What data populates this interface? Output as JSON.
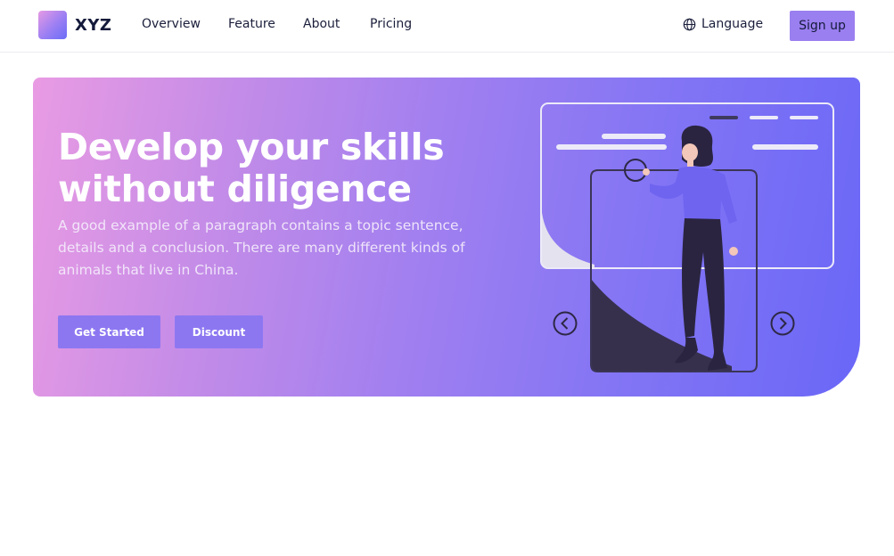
{
  "brand": {
    "name": "XYZ"
  },
  "nav": {
    "links": [
      "Overview",
      "Feature",
      "About",
      "Pricing"
    ],
    "language_label": "Language",
    "signup_label": "Sign up"
  },
  "hero": {
    "title": "Develop your skills without diligence",
    "description": "A good example of a paragraph contains a topic sentence, details and a conclusion. There are many different kinds of animals that live in China.",
    "primary_button": "Get Started",
    "secondary_button": "Discount"
  },
  "colors": {
    "accent": "#9a7ff0",
    "gradient_start": "#e99be3",
    "gradient_end": "#6a67f7",
    "text_dark": "#141a3a"
  },
  "icons": {
    "language": "globe-icon",
    "prev": "chevron-left-icon",
    "next": "chevron-right-icon"
  }
}
